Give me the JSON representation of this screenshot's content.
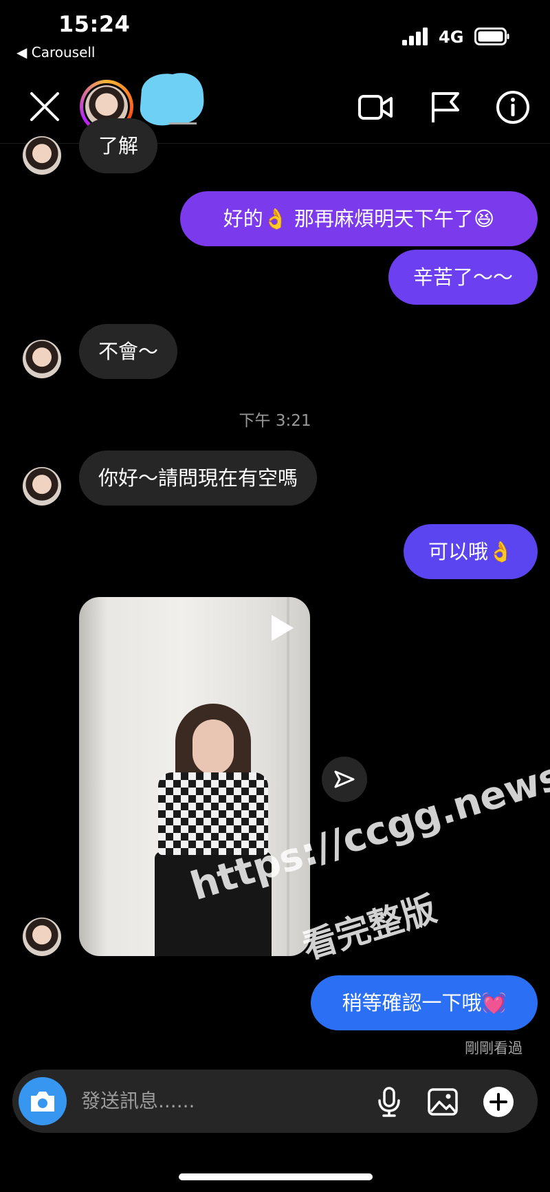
{
  "status_bar": {
    "time": "15:24",
    "back_app": "◀ Carousell",
    "network": "4G"
  },
  "header": {
    "icons": [
      "close-icon",
      "video-call-icon",
      "flag-icon",
      "info-icon"
    ]
  },
  "messages": {
    "m0": "了解",
    "m1": "好的👌 那再麻煩明天下午了😆",
    "m2": "辛苦了～～",
    "m3": "不會～",
    "timestamp": "下午 3:21",
    "m4": "你好～請問現在有空嗎",
    "m5": "可以哦👌",
    "m6": "稍等確認一下哦💓",
    "seen": "剛剛看過"
  },
  "watermark": {
    "line1": "https://ccgg.news",
    "line2": "看完整版"
  },
  "composer": {
    "placeholder": "發送訊息......"
  },
  "colors": {
    "outgoing_purple": "#7c3aed",
    "outgoing_violet": "#5b45f0",
    "outgoing_blue": "#2b6ff5",
    "incoming": "#262626",
    "camera": "#3797f0"
  }
}
